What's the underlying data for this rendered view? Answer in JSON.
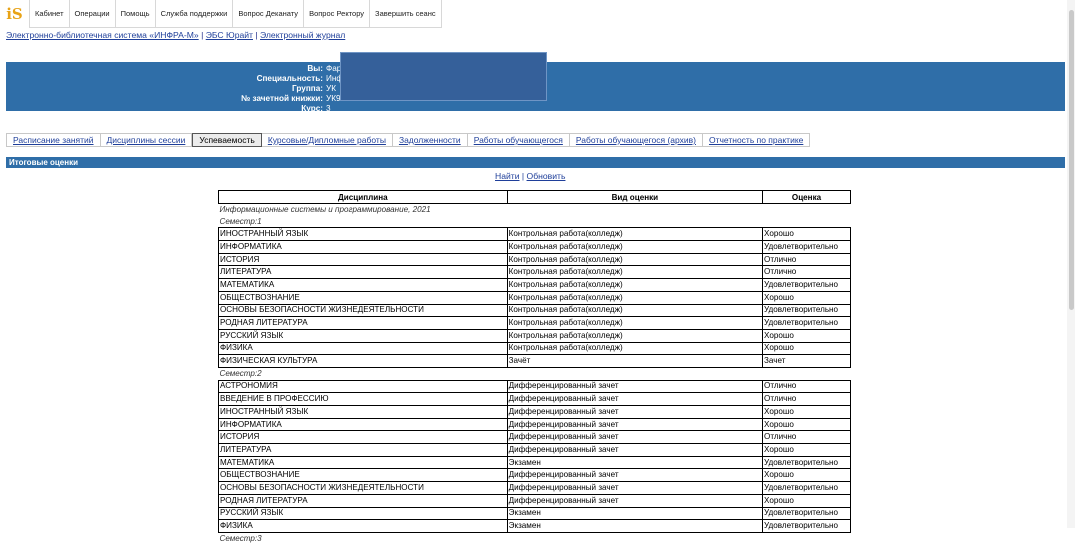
{
  "logo": "iS",
  "nav": [
    "Кабинет",
    "Операции",
    "Помощь",
    "Служба поддержки",
    "Вопрос Деканату",
    "Вопрос Ректору",
    "Завершить сеанс"
  ],
  "links": [
    "Электронно-библиотечная система «ИНФРА-М»",
    "ЭБС Юрайт",
    "Электронный журнал"
  ],
  "student": {
    "rows": [
      {
        "label": "Вы:",
        "value": "Фар"
      },
      {
        "label": "Специальность:",
        "value": "Инф"
      },
      {
        "label": "Группа:",
        "value": "УК"
      },
      {
        "label": "№ зачетной книжки:",
        "value": "УК9"
      },
      {
        "label": "Курс:",
        "value": "3"
      }
    ]
  },
  "tabs": [
    "Расписание занятий",
    "Дисциплины сессии",
    "Успеваемость",
    "Курсовые/Дипломные работы",
    "Задолженности",
    "Работы обучающегося",
    "Работы обучающегося (архив)",
    "Отчетность по практике"
  ],
  "active_tab": "Успеваемость",
  "section_title": "Итоговые оценки",
  "actions": {
    "find": "Найти",
    "refresh": "Обновить"
  },
  "table": {
    "headers": [
      "Дисциплина",
      "Вид оценки",
      "Оценка"
    ],
    "program": "Информационные системы и программирование, 2021",
    "semesters": [
      {
        "label": "Семестр:1",
        "rows": [
          [
            "ИНОСТРАННЫЙ ЯЗЫК",
            "Контрольная работа(колледж)",
            "Хорошо"
          ],
          [
            "ИНФОРМАТИКА",
            "Контрольная работа(колледж)",
            "Удовлетворительно"
          ],
          [
            "ИСТОРИЯ",
            "Контрольная работа(колледж)",
            "Отлично"
          ],
          [
            "ЛИТЕРАТУРА",
            "Контрольная работа(колледж)",
            "Отлично"
          ],
          [
            "МАТЕМАТИКА",
            "Контрольная работа(колледж)",
            "Удовлетворительно"
          ],
          [
            "ОБЩЕСТВОЗНАНИЕ",
            "Контрольная работа(колледж)",
            "Хорошо"
          ],
          [
            "ОСНОВЫ БЕЗОПАСНОСТИ ЖИЗНЕДЕЯТЕЛЬНОСТИ",
            "Контрольная работа(колледж)",
            "Удовлетворительно"
          ],
          [
            "РОДНАЯ ЛИТЕРАТУРА",
            "Контрольная работа(колледж)",
            "Удовлетворительно"
          ],
          [
            "РУССКИЙ ЯЗЫК",
            "Контрольная работа(колледж)",
            "Хорошо"
          ],
          [
            "ФИЗИКА",
            "Контрольная работа(колледж)",
            "Хорошо"
          ],
          [
            "ФИЗИЧЕСКАЯ КУЛЬТУРА",
            "Зачёт",
            "Зачет"
          ]
        ]
      },
      {
        "label": "Семестр:2",
        "rows": [
          [
            "АСТРОНОМИЯ",
            "Дифференцированный зачет",
            "Отлично"
          ],
          [
            "ВВЕДЕНИЕ В ПРОФЕССИЮ",
            "Дифференцированный зачет",
            "Отлично"
          ],
          [
            "ИНОСТРАННЫЙ ЯЗЫК",
            "Дифференцированный зачет",
            "Хорошо"
          ],
          [
            "ИНФОРМАТИКА",
            "Дифференцированный зачет",
            "Хорошо"
          ],
          [
            "ИСТОРИЯ",
            "Дифференцированный зачет",
            "Отлично"
          ],
          [
            "ЛИТЕРАТУРА",
            "Дифференцированный зачет",
            "Хорошо"
          ],
          [
            "МАТЕМАТИКА",
            "Экзамен",
            "Удовлетворительно"
          ],
          [
            "ОБЩЕСТВОЗНАНИЕ",
            "Дифференцированный зачет",
            "Хорошо"
          ],
          [
            "ОСНОВЫ БЕЗОПАСНОСТИ ЖИЗНЕДЕЯТЕЛЬНОСТИ",
            "Дифференцированный зачет",
            "Удовлетворительно"
          ],
          [
            "РОДНАЯ ЛИТЕРАТУРА",
            "Дифференцированный зачет",
            "Хорошо"
          ],
          [
            "РУССКИЙ ЯЗЫК",
            "Экзамен",
            "Удовлетворительно"
          ],
          [
            "ФИЗИКА",
            "Экзамен",
            "Удовлетворительно"
          ]
        ]
      },
      {
        "label": "Семестр:3",
        "rows": []
      }
    ]
  }
}
